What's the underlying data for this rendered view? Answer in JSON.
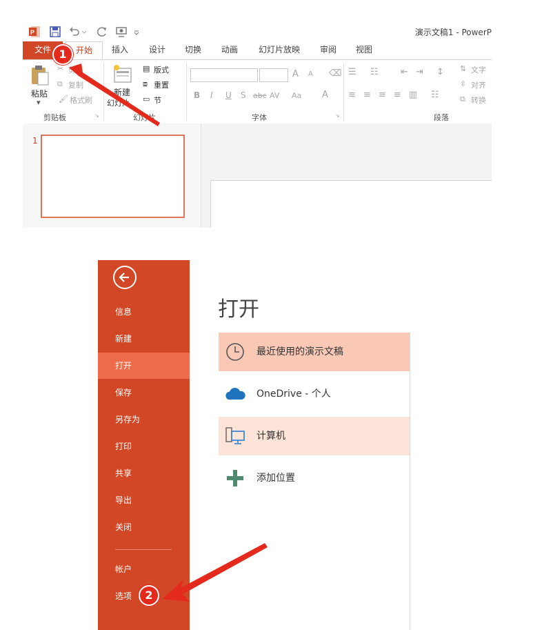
{
  "window_title": "演示文稿1 - PowerP",
  "tabs": [
    "文件",
    "开始",
    "插入",
    "设计",
    "切换",
    "动画",
    "幻灯片放映",
    "审阅",
    "视图"
  ],
  "ribbon": {
    "clipboard": {
      "paste": "粘贴",
      "cut": "剪",
      "copy": "复制",
      "format_painter": "格式刷",
      "group_label": "剪贴板"
    },
    "slides": {
      "new_slide_line1": "新建",
      "new_slide_line2": "幻灯片",
      "layout": "版式",
      "reset": "重置",
      "section": "节",
      "group_label": "幻灯片"
    },
    "font": {
      "bold": "B",
      "italic": "I",
      "underline": "U",
      "shadow": "S",
      "strike": "abc",
      "spacing": "AV",
      "case": "Aa",
      "color": "A",
      "grow": "A",
      "shrink": "A",
      "group_label": "字体"
    },
    "paragraph": {
      "text_direction": "文字",
      "align_text": "对齐",
      "convert": "转换",
      "group_label": "段落"
    }
  },
  "slide_pane": {
    "thumb_number": "1"
  },
  "backstage": {
    "nav": [
      "信息",
      "新建",
      "打开",
      "保存",
      "另存为",
      "打印",
      "共享",
      "导出",
      "关闭",
      "帐户",
      "选项"
    ],
    "active_nav": "打开",
    "title": "打开",
    "places": [
      {
        "label": "最近使用的演示文稿",
        "icon": "clock-icon"
      },
      {
        "label": "OneDrive - 个人",
        "icon": "onedrive-cloud-icon"
      },
      {
        "label": "计算机",
        "icon": "computer-icon"
      },
      {
        "label": "添加位置",
        "icon": "plus-icon"
      }
    ]
  },
  "annotations": {
    "step1": "1",
    "step2": "2"
  },
  "colors": {
    "accent": "#d24726",
    "nav_active": "#ed6d4a",
    "place_recent_bg": "#f9c9b5",
    "place_computer_bg": "#fce4d9",
    "annotation_red": "#e42a1c"
  }
}
